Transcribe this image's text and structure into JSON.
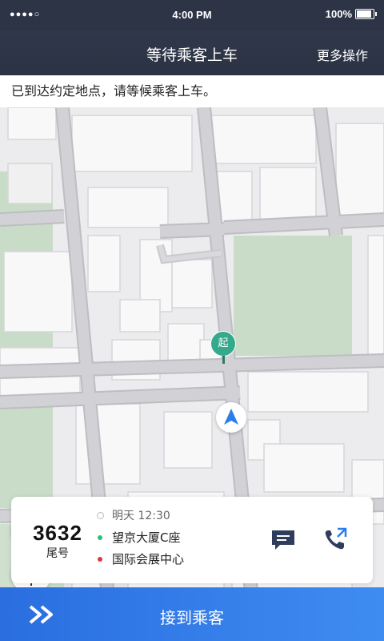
{
  "status_bar": {
    "signal": "●●●●○",
    "time": "4:00 PM",
    "battery": "100%"
  },
  "nav": {
    "title": "等待乘客上车",
    "more_label": "更多操作"
  },
  "notice": {
    "text": "已到达约定地点，请等候乘客上车。"
  },
  "map": {
    "start_marker_label": "起",
    "colors": {
      "road": "#cfcfd3",
      "road_edge": "#bdbdc2",
      "block": "#f7f7f7",
      "building_edge": "#d4d4d8",
      "park": "#c5dcc5",
      "marker": "#34a98b",
      "arrow": "#2b7de9"
    },
    "controls": {
      "traffic_icon": "traffic-light-icon",
      "locate_icon": "crosshair-icon"
    }
  },
  "order": {
    "tail_number": "3632",
    "tail_label": "尾号",
    "time": "明天 12:30",
    "pickup": "望京大厦C座",
    "dropoff": "国际会展中心",
    "pickup_color": "#2ebf77",
    "dropoff_color": "#e0383a",
    "message_icon": "chat-icon",
    "call_icon": "phone-icon"
  },
  "action": {
    "label": "接到乘客",
    "icon": "double-chevron-right-icon"
  }
}
